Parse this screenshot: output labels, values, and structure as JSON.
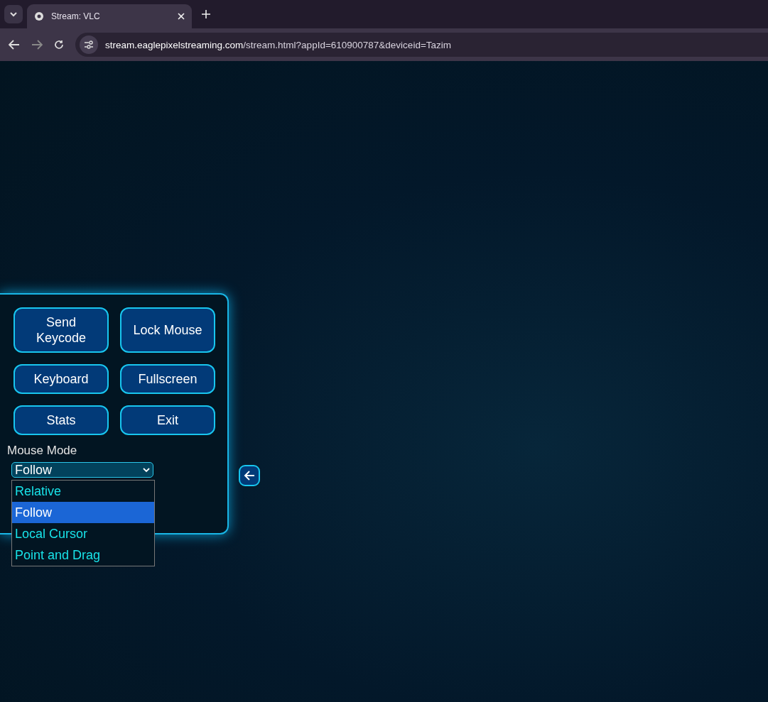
{
  "browser": {
    "tab": {
      "title": "Stream: VLC"
    },
    "url_host": "stream.eaglepixelstreaming.com",
    "url_path": "/stream.html?appId=610900787&deviceid=Tazim"
  },
  "panel": {
    "buttons": [
      {
        "label": "Send Keycode"
      },
      {
        "label": "Lock Mouse"
      },
      {
        "label": "Keyboard"
      },
      {
        "label": "Fullscreen"
      },
      {
        "label": "Stats"
      },
      {
        "label": "Exit"
      }
    ],
    "mouse_mode": {
      "label": "Mouse Mode",
      "value": "Follow",
      "expanded": true,
      "options": [
        {
          "label": "Relative",
          "selected": false
        },
        {
          "label": "Follow",
          "selected": true
        },
        {
          "label": "Local Cursor",
          "selected": false
        },
        {
          "label": "Point and Drag",
          "selected": false
        }
      ]
    }
  }
}
